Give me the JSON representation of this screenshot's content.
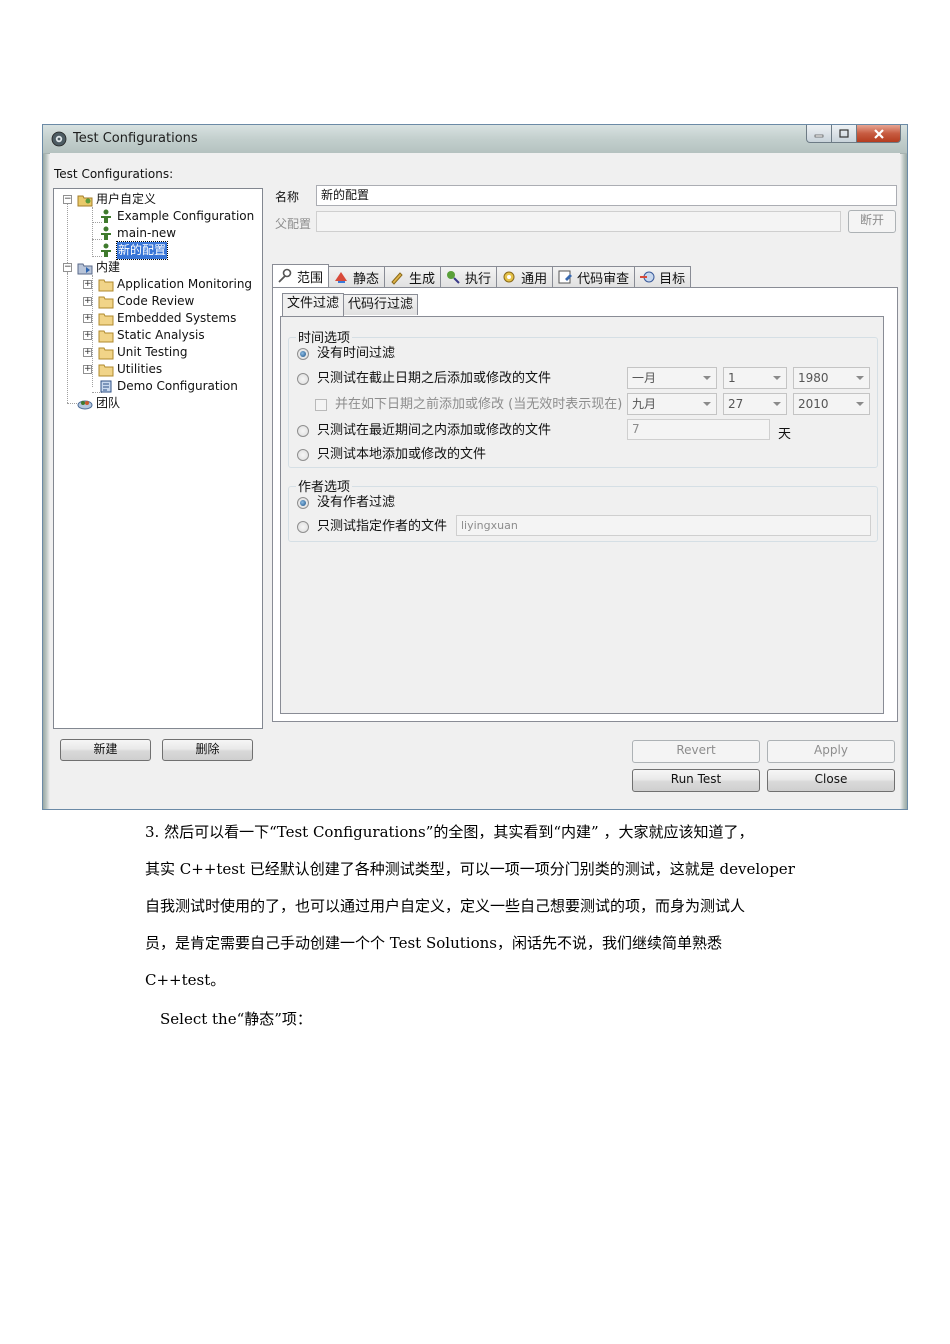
{
  "window": {
    "title": "Test Configurations",
    "controls": {
      "minimize": "minimize-icon",
      "maximize": "maximize-icon",
      "close": "close-icon"
    }
  },
  "left": {
    "label": "Test Configurations:",
    "tree": [
      {
        "label": "用户自定义",
        "icon": "user-folder-icon",
        "expanded": true
      },
      {
        "label": "Example Configuration",
        "icon": "config-icon"
      },
      {
        "label": "main-new",
        "icon": "config-icon"
      },
      {
        "label": "新的配置",
        "icon": "config-icon",
        "selected": true
      },
      {
        "label": "内建",
        "icon": "builtin-folder-icon",
        "expanded": true
      },
      {
        "label": "Application Monitoring",
        "icon": "folder-icon"
      },
      {
        "label": "Code Review",
        "icon": "folder-icon"
      },
      {
        "label": "Embedded Systems",
        "icon": "folder-icon"
      },
      {
        "label": "Static Analysis",
        "icon": "folder-icon"
      },
      {
        "label": "Unit Testing",
        "icon": "folder-icon"
      },
      {
        "label": "Utilities",
        "icon": "folder-icon"
      },
      {
        "label": "Demo Configuration",
        "icon": "config-icon"
      },
      {
        "label": "团队",
        "icon": "team-icon"
      }
    ],
    "new_button": "新建",
    "delete_button": "删除"
  },
  "form": {
    "name_label": "名称",
    "name_value": "新的配置",
    "parent_label": "父配置",
    "parent_value": "",
    "disconnect_button": "断开"
  },
  "tabs": [
    {
      "label": "范围",
      "icon": "key-icon",
      "active": true
    },
    {
      "label": "静态",
      "icon": "static-icon"
    },
    {
      "label": "生成",
      "icon": "generate-icon"
    },
    {
      "label": "执行",
      "icon": "execute-icon"
    },
    {
      "label": "通用",
      "icon": "common-icon"
    },
    {
      "label": "代码审查",
      "icon": "code-review-icon"
    },
    {
      "label": "目标",
      "icon": "target-icon"
    }
  ],
  "subtabs": [
    {
      "label": "文件过滤",
      "active": true
    },
    {
      "label": "代码行过滤"
    }
  ],
  "time_group": {
    "title": "时间选项",
    "opt_none": "没有时间过滤",
    "opt_after": "只测试在截止日期之后添加或修改的文件",
    "after_month": "一月",
    "after_day": "1",
    "after_year": "1980",
    "opt_before": "并在如下日期之前添加或修改 (当无效时表示现在)",
    "before_month": "九月",
    "before_day": "27",
    "before_year": "2010",
    "opt_recent": "只测试在最近期间之内添加或修改的文件",
    "recent_days": "7",
    "days_unit": "天",
    "opt_local": "只测试本地添加或修改的文件",
    "selected": "none"
  },
  "author_group": {
    "title": "作者选项",
    "opt_none": "没有作者过滤",
    "opt_author": "只测试指定作者的文件",
    "author_value": "liyingxuan",
    "selected": "none"
  },
  "buttons": {
    "revert": "Revert",
    "apply": "Apply",
    "run_test": "Run Test",
    "close": "Close"
  },
  "doc": {
    "lines": [
      "3. 然后可以看一下“Test Configurations”的全图，其实看到“内建” ，大家就应该知道了，",
      "其实 C++test 已经默认创建了各种测试类型，可以一项一项分门别类的测试，这就是 developer",
      "自我测试时使用的了，也可以通过用户自定义，定义一些自己想要测试的项，而身为测试人",
      "员，是肯定需要自己手动创建一个个 Test Solutions，闲话先不说，我们继续简单熟悉",
      "C++test。"
    ],
    "select_line": "Select the“静态”项："
  }
}
